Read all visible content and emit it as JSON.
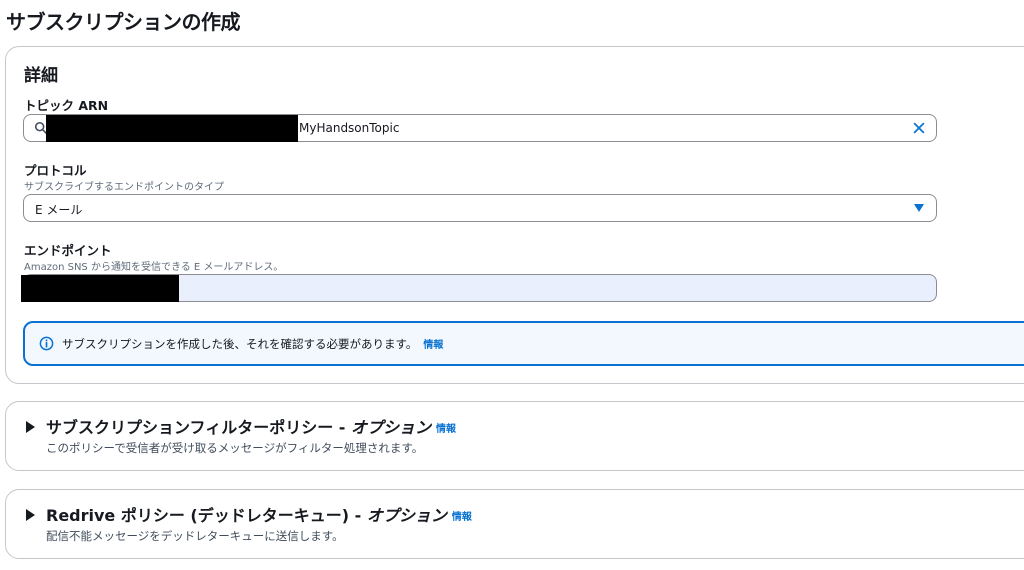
{
  "page": {
    "title": "サブスクリプションの作成"
  },
  "details": {
    "heading": "詳細",
    "topic_arn": {
      "label": "トピック ARN",
      "value_suffix": "MyHandsonTopic"
    },
    "protocol": {
      "label": "プロトコル",
      "description": "サブスクライブするエンドポイントのタイプ",
      "selected": "E メール"
    },
    "endpoint": {
      "label": "エンドポイント",
      "description": "Amazon SNS から通知を受信できる E メールアドレス。"
    },
    "alert": {
      "text": "サブスクリプションを作成した後、それを確認する必要があります。",
      "link": "情報"
    }
  },
  "filter_policy": {
    "title": "サブスクリプションフィルターポリシー - ",
    "optional": "オプション",
    "info": "情報",
    "description": "このポリシーで受信者が受け取るメッセージがフィルター処理されます。"
  },
  "redrive_policy": {
    "title": "Redrive ポリシー (デッドレターキュー) - ",
    "optional": "オプション",
    "info": "情報",
    "description": "配信不能メッセージをデッドレターキューに送信します。"
  },
  "colors": {
    "accent": "#0972d3",
    "border": "#c6c6cd",
    "endpoint_bg": "#e9effd"
  },
  "icons": [
    "search-icon",
    "clear-icon",
    "caret-down-icon",
    "info-icon",
    "caret-right-icon"
  ]
}
